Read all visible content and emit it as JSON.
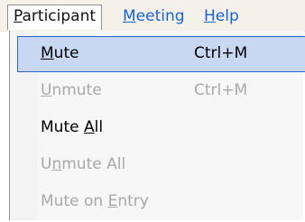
{
  "menubar": {
    "items": [
      {
        "prefix": "",
        "mnemonic": "P",
        "suffix": "articipant"
      },
      {
        "prefix": "",
        "mnemonic": "M",
        "suffix": "eeting"
      },
      {
        "prefix": "",
        "mnemonic": "H",
        "suffix": "elp"
      }
    ]
  },
  "menu": {
    "items": [
      {
        "prefix": "",
        "mnemonic": "M",
        "suffix": "ute",
        "shortcut": "Ctrl+M",
        "enabled": true,
        "highlighted": true
      },
      {
        "prefix": "",
        "mnemonic": "U",
        "suffix": "nmute",
        "shortcut": "Ctrl+M",
        "enabled": false,
        "highlighted": false
      },
      {
        "prefix": "Mute ",
        "mnemonic": "A",
        "suffix": "ll",
        "shortcut": "",
        "enabled": true,
        "highlighted": false
      },
      {
        "prefix": "U",
        "mnemonic": "n",
        "suffix": "mute All",
        "shortcut": "",
        "enabled": false,
        "highlighted": false
      },
      {
        "prefix": "Mute on ",
        "mnemonic": "E",
        "suffix": "ntry",
        "shortcut": "",
        "enabled": false,
        "highlighted": false
      }
    ]
  }
}
